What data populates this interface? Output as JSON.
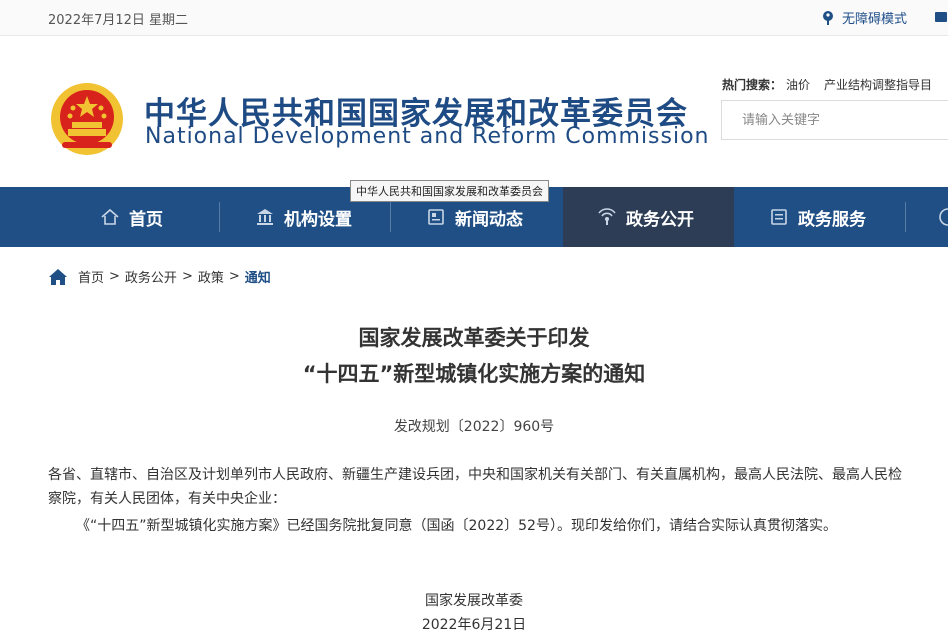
{
  "topbar": {
    "date": "2022年7月12日 星期二",
    "accessibility_label": "无障碍模式"
  },
  "header": {
    "title_cn": "中华人民共和国国家发展和改革委员会",
    "title_en": "National Development and Reform Commission",
    "hot_search_label": "热门搜索：",
    "hot_search_items": [
      "油价",
      "产业结构调整指导目"
    ],
    "search_placeholder": "请输入关键字"
  },
  "tooltip": "中华人民共和国国家发展和改革委员会",
  "nav": {
    "items": [
      {
        "label": "首页",
        "icon": "home-icon"
      },
      {
        "label": "机构设置",
        "icon": "institution-icon"
      },
      {
        "label": "新闻动态",
        "icon": "news-icon"
      },
      {
        "label": "政务公开",
        "icon": "broadcast-icon"
      },
      {
        "label": "政务服务",
        "icon": "service-icon"
      }
    ],
    "active_index": 3
  },
  "breadcrumb": {
    "items": [
      "首页",
      "政务公开",
      "政策"
    ],
    "current": "通知",
    "separator": ">"
  },
  "article": {
    "title_line1": "国家发展改革委关于印发",
    "title_line2": "“十四五”新型城镇化实施方案的通知",
    "doc_number": "发改规划〔2022〕960号",
    "para1": "各省、直辖市、自治区及计划单列市人民政府、新疆生产建设兵团，中央和国家机关有关部门、有关直属机构，最高人民法院、最高人民检察院，有关人民团体，有关中央企业：",
    "para2": "《“十四五”新型城镇化实施方案》已经国务院批复同意（国函〔2022〕52号）。现印发给你们，请结合实际认真贯彻落实。",
    "signer": "国家发展改革委",
    "sign_date": "2022年6月21日"
  },
  "colors": {
    "brand_blue": "#1f4f85",
    "nav_active": "#2d3d55",
    "emblem_red": "#d7231b",
    "emblem_gold": "#f1c232"
  }
}
